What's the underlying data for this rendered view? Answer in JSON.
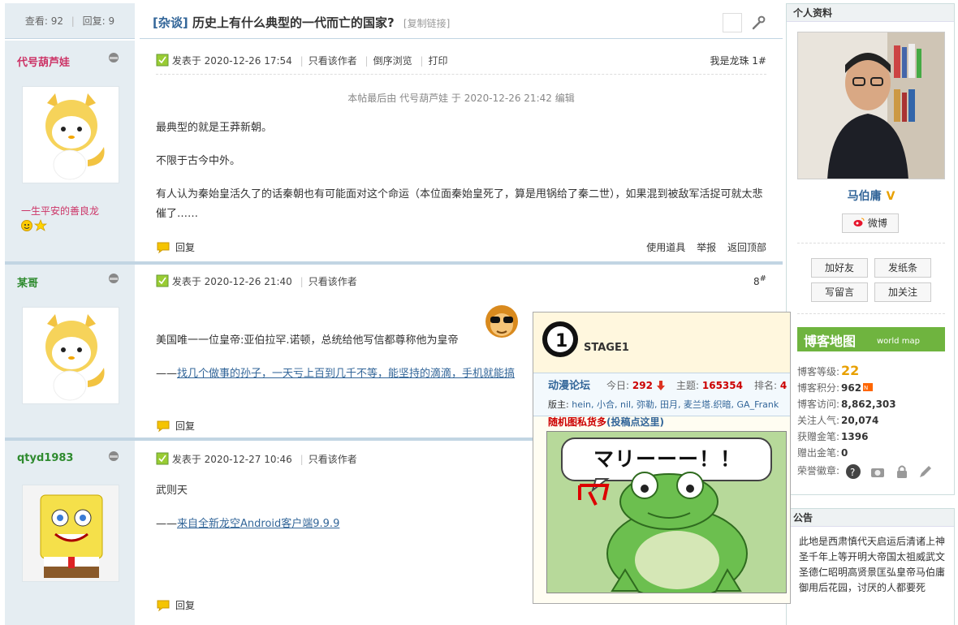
{
  "thread": {
    "views_label": "查看:",
    "views": "92",
    "replies_label": "回复:",
    "replies": "9",
    "category": "[杂谈]",
    "title": "历史上有什么典型的一代而亡的国家?",
    "copy_link": "[复制链接]"
  },
  "posts": [
    {
      "author": "代号葫芦娃",
      "user_title": "一生平安的善良龙",
      "meta_prefix": "发表于",
      "time": "2020-12-26 17:54",
      "action_only_author": "只看该作者",
      "action_reverse": "倒序浏览",
      "action_print": "打印",
      "floor": "我是龙珠 1#",
      "edit_note": "本帖最后由 代号葫芦娃 于 2020-12-26 21:42 编辑",
      "paragraphs": [
        "最典型的就是王莽新朝。",
        "不限于古今中外。",
        "有人认为秦始皇活久了的话秦朝也有可能面对这个命运（本位面秦始皇死了，算是甩锅给了秦二世），如果混到被敌军活捉可就太悲催了……"
      ],
      "reply_label": "回复",
      "use_tool": "使用道具",
      "report": "举报",
      "back_top": "返回顶部"
    },
    {
      "author": "某哥",
      "meta_prefix": "发表于",
      "time": "2020-12-26 21:40",
      "action_only_author": "只看该作者",
      "floor": "8",
      "floor_sup": "#",
      "body": "美国唯一一位皇帝:亚伯拉罕.诺顿，总统给他写信都尊称他为皇帝",
      "sig_prefix": "——",
      "sig_link": "找几个做事的孙子，一天亏上百到几千不等，能坚持的滴滴，手机就能搞",
      "reply_label": "回复"
    },
    {
      "author": "qtyd1983",
      "meta_prefix": "发表于",
      "time": "2020-12-27 10:46",
      "action_only_author": "只看该作者",
      "body": "武则天",
      "sig_prefix": "——",
      "sig_link": "来自全新龙空Android客户端9.9.9",
      "reply_label": "回复"
    }
  ],
  "profile": {
    "head": "个人资料",
    "name": "马伯庸",
    "vip_mark": "V",
    "weibo": "微博",
    "add_friend": "加好友",
    "send_note": "发纸条",
    "leave_msg": "写留言",
    "follow": "加关注",
    "blog_map": "博客地图",
    "blog_map_sub": "world map",
    "stats": [
      {
        "label": "博客等级:",
        "value": "22"
      },
      {
        "label": "博客积分:",
        "value": "962"
      },
      {
        "label": "博客访问:",
        "value": "8,862,303"
      },
      {
        "label": "关注人气:",
        "value": "20,074"
      },
      {
        "label": "获赠金笔:",
        "value": "1396"
      },
      {
        "label": "赠出金笔:",
        "value": "0"
      },
      {
        "label": "荣誉徽章:",
        "value": ""
      }
    ]
  },
  "notice": {
    "head": "公告",
    "text": "此地是西肃慎代天启运后清诸上神圣千年上等开明大帝国太祖威武文圣德仁昭明高贤景匡弘皇帝马伯庸御用后花园，讨厌的人都要死"
  },
  "popup": {
    "stage_title": "STAGE1",
    "forum_name": "动漫论坛",
    "today_label": "今日:",
    "today": "292",
    "topics_label": "主题:",
    "topics": "165354",
    "rank_label": "排名:",
    "rank": "4",
    "moderators_label": "版主:",
    "moderators": "hein, 小合, nil, 弥勒, 田月, 麦兰塔.织暗, GA_Frank",
    "promo_red": "随机图私货多",
    "promo_blue": "(投稿点这里)",
    "speech": "マリーーー！！"
  },
  "colors": {
    "sidebar_bg": "#e5edf2",
    "divider": "#c2d5e3",
    "link": "#336699",
    "author_pink": "#cc3366",
    "author_green": "#2f8b2f",
    "accent_red": "#cc0000"
  }
}
